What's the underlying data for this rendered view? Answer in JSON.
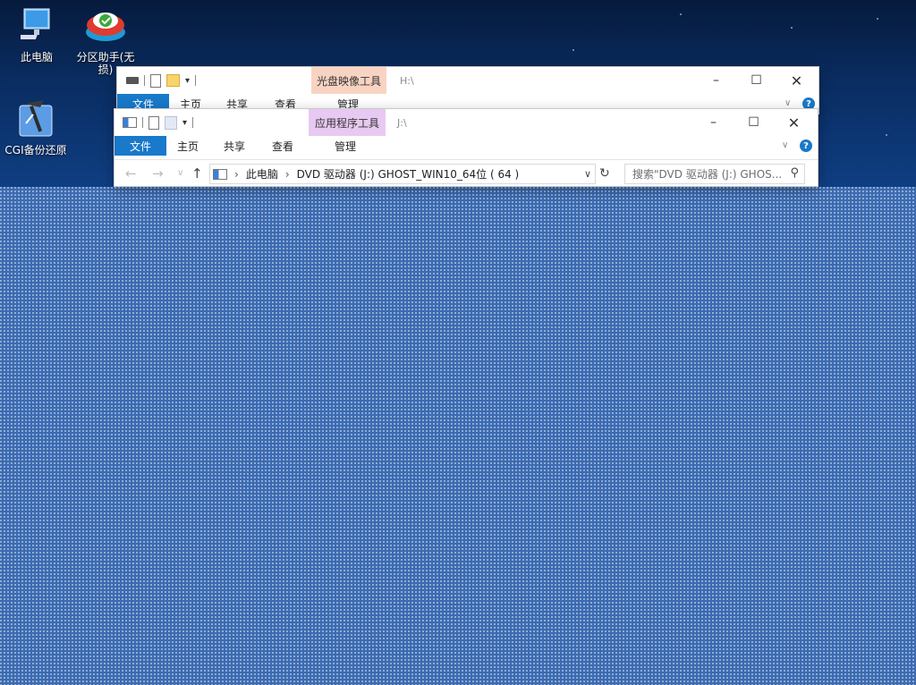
{
  "desktop": {
    "icons": [
      {
        "label": "此电脑"
      },
      {
        "label": "分区助手(无损)"
      },
      {
        "label": "CGI备份还原"
      }
    ]
  },
  "window_back": {
    "context_tab": "光盘映像工具",
    "path": "H:\\",
    "tabs": {
      "file": "文件",
      "home": "主页",
      "share": "共享",
      "view": "查看",
      "manage": "管理"
    },
    "context_color": "#f9d3c2"
  },
  "window_front": {
    "context_tab": "应用程序工具",
    "path": "J:\\",
    "tabs": {
      "file": "文件",
      "home": "主页",
      "share": "共享",
      "view": "查看",
      "manage": "管理"
    },
    "context_color": "#e8c9f1",
    "address": {
      "crumbs": [
        "此电脑",
        "DVD 驱动器 (J:) GHOST_WIN10_64位 ( 64 )"
      ]
    },
    "search": {
      "placeholder": "搜索\"DVD 驱动器 (J:) GHOS..."
    }
  },
  "colors": {
    "accent": "#1979ca"
  }
}
